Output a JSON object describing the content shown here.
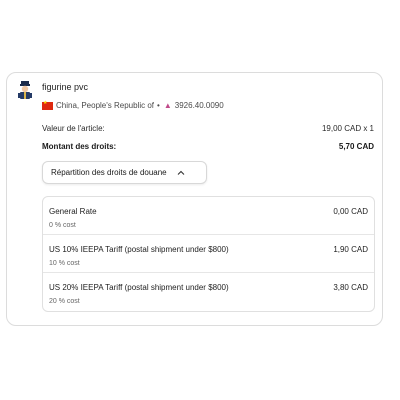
{
  "product": {
    "name": "figurine pvc",
    "origin": "China, People's Republic of",
    "separator": "•",
    "hs_code": "3926.40.0090"
  },
  "summary": {
    "item_value_label": "Valeur de l'article:",
    "item_value": "19,00 CAD x 1",
    "duties_label": "Montant des droits:",
    "duties_value": "5,70 CAD"
  },
  "breakdown": {
    "toggle_label": "Répartition des droits de douane",
    "rows": [
      {
        "name": "General Rate",
        "sub": "0 % cost",
        "amount": "0,00 CAD"
      },
      {
        "name": "US 10% IEEPA Tariff (postal shipment under $800)",
        "sub": "10 % cost",
        "amount": "1,90 CAD"
      },
      {
        "name": "US 20% IEEPA Tariff (postal shipment under $800)",
        "sub": "20 % cost",
        "amount": "3,80 CAD"
      }
    ]
  },
  "icons": {
    "avatar": "figurine-avatar-icon",
    "flag": "china-flag-icon",
    "hs": "tariff-code-icon",
    "chevron": "chevron-up-icon"
  },
  "colors": {
    "border": "#dcdcdc",
    "flag_red": "#de2910"
  }
}
